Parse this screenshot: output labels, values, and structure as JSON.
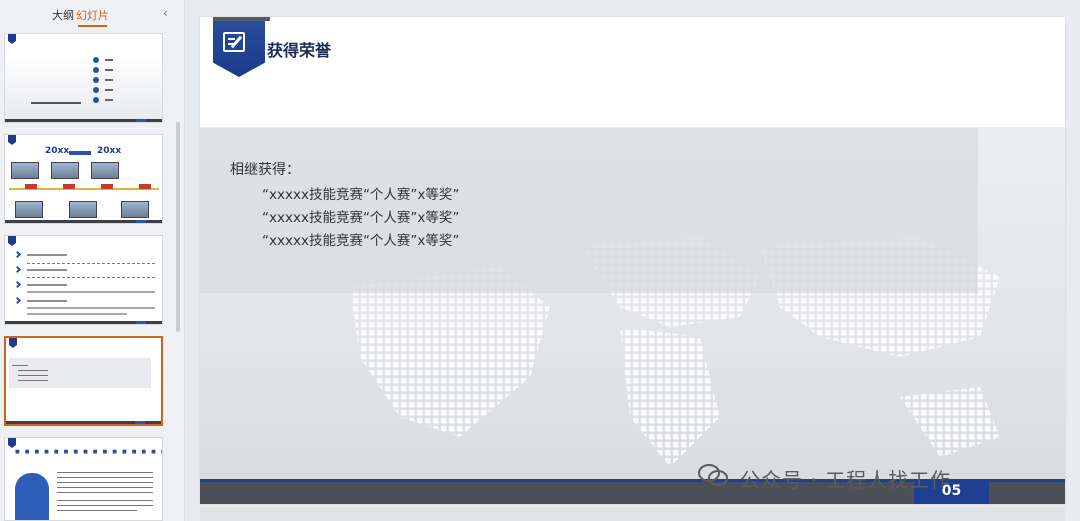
{
  "sidebar": {
    "tabs": [
      {
        "label": "大纲"
      },
      {
        "label": "幻灯片"
      }
    ],
    "collapse_glyph": "‹",
    "selected_index": 3
  },
  "slide": {
    "title": "获得荣誉",
    "lead": "相继获得：",
    "awards": [
      "“xxxxx技能竞赛“个人赛”x等奖”",
      "“xxxxx技能竞赛“个人赛”x等奖”",
      "“xxxxx技能竞赛“个人赛”x等奖”"
    ],
    "page_number": "05",
    "icon": "edit-icon"
  },
  "thumbnails": {
    "t2_year_a": "20xx",
    "t2_year_b": "20xx"
  },
  "watermark": "公众号 · 工程人找工作",
  "colors": {
    "accent": "#1f3f93",
    "active_tab": "#d0641f",
    "footer": "#4b4f57"
  }
}
